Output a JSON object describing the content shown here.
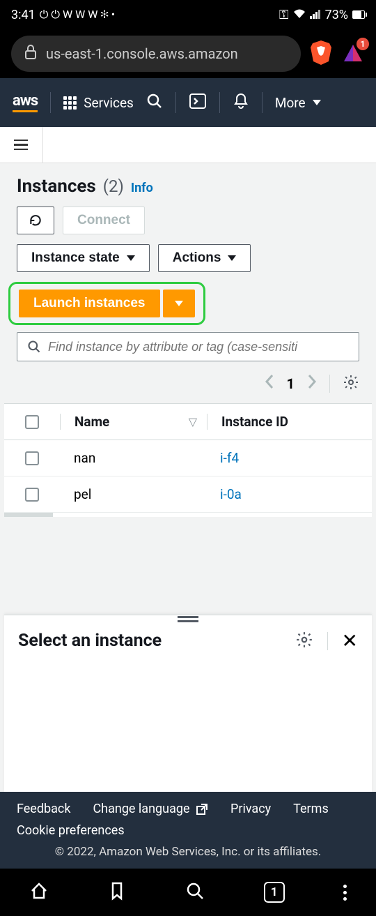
{
  "status": {
    "time": "3:41",
    "battery": "73%"
  },
  "browser": {
    "url": "us-east-1.console.aws.amazon",
    "tab_count": "1",
    "badge_count": "1"
  },
  "nav": {
    "logo": "aws",
    "services": "Services",
    "more": "More"
  },
  "page": {
    "title": "Instances",
    "count": "(2)",
    "info": "Info"
  },
  "buttons": {
    "connect": "Connect",
    "instance_state": "Instance state",
    "actions": "Actions",
    "launch": "Launch instances"
  },
  "search": {
    "placeholder": "Find instance by attribute or tag (case-sensiti"
  },
  "pagination": {
    "current": "1"
  },
  "table": {
    "headers": {
      "name": "Name",
      "instance_id": "Instance ID"
    },
    "rows": [
      {
        "name": "nan",
        "id": "i-f4"
      },
      {
        "name": "pel",
        "id": "i-0a"
      }
    ]
  },
  "panel": {
    "title": "Select an instance"
  },
  "footer": {
    "feedback": "Feedback",
    "change_language": "Change language",
    "privacy": "Privacy",
    "terms": "Terms",
    "cookies": "Cookie preferences",
    "copyright": "© 2022, Amazon Web Services, Inc. or its affiliates."
  }
}
